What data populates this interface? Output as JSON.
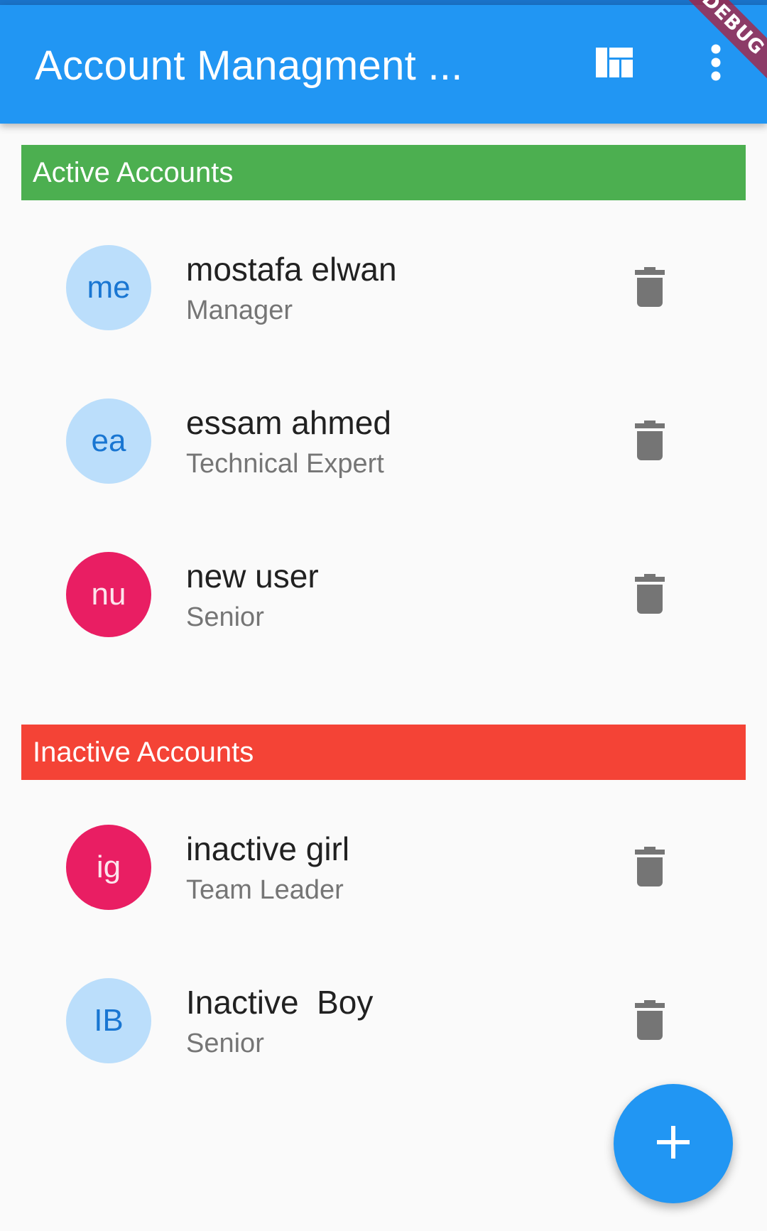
{
  "appbar": {
    "title": "Account Managment ...",
    "actions": [
      {
        "icon": "dashboard-icon"
      },
      {
        "icon": "more-vert-icon"
      }
    ]
  },
  "debug_banner": "DEBUG",
  "sections": {
    "active": {
      "label": "Active Accounts",
      "color": "#4caf50",
      "accounts": [
        {
          "initials": "me",
          "name": "mostafa elwan",
          "role": "Manager"
        },
        {
          "initials": "ea",
          "name": "essam ahmed",
          "role": "Technical Expert"
        },
        {
          "initials": "nu",
          "name": "new user",
          "role": "Senior"
        }
      ]
    },
    "inactive": {
      "label": "Inactive Accounts",
      "color": "#f44336",
      "accounts": [
        {
          "initials": "ig",
          "name": "inactive girl",
          "role": "Team Leader"
        },
        {
          "initials": "IB",
          "name": "Inactive  Boy",
          "role": "Senior"
        }
      ]
    }
  },
  "fab": {
    "icon": "add-icon"
  },
  "colors": {
    "primary": "#2196f3",
    "avatar_light": "#bbdefb",
    "avatar_pink": "#e91e63",
    "icon_grey": "#757575"
  }
}
